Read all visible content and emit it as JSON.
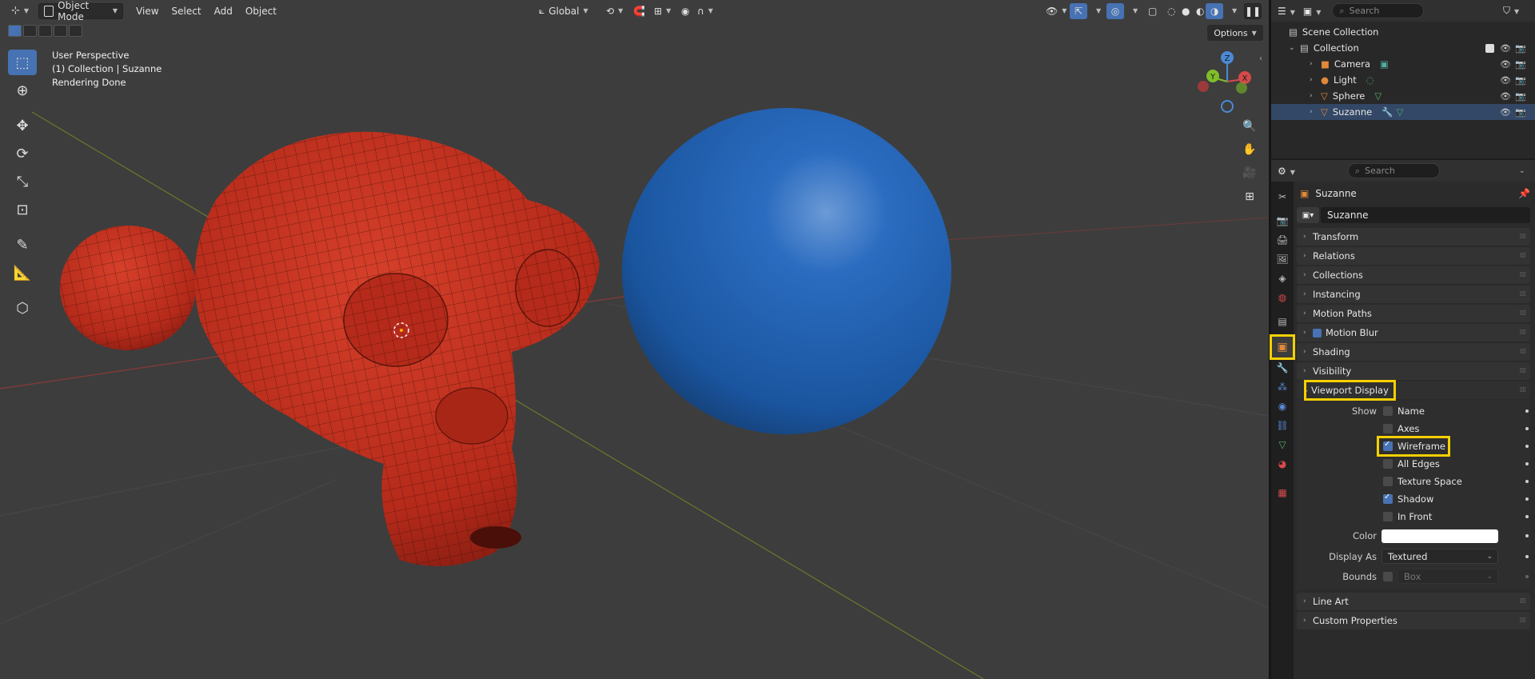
{
  "viewport": {
    "header": {
      "mode": "Object Mode",
      "menus": [
        "View",
        "Select",
        "Add",
        "Object"
      ],
      "transform_orientation": "Global",
      "options_label": "Options"
    },
    "info": {
      "line1": "User Perspective",
      "line2": "(1) Collection | Suzanne",
      "line3": "Rendering Done"
    },
    "gizmo": {
      "z": "Z",
      "y": "Y",
      "x": "X"
    },
    "colors": {
      "suzanne": "#c0301f",
      "sphere": "#1e5fb0",
      "background": "#3d3d3d",
      "accent": "#4772b3",
      "highlight": "#f5d000"
    }
  },
  "outliner": {
    "search_placeholder": "Search",
    "scene_collection": "Scene Collection",
    "collection": "Collection",
    "items": [
      {
        "label": "Camera",
        "icon": "camera-icon"
      },
      {
        "label": "Light",
        "icon": "light-icon"
      },
      {
        "label": "Sphere",
        "icon": "mesh-icon"
      },
      {
        "label": "Suzanne",
        "icon": "mesh-icon"
      }
    ]
  },
  "properties": {
    "search_placeholder": "Search",
    "object_name_title": "Suzanne",
    "object_name_field": "Suzanne",
    "panels": [
      "Transform",
      "Relations",
      "Collections",
      "Instancing",
      "Motion Paths",
      "Motion Blur",
      "Shading",
      "Visibility"
    ],
    "viewport_display": {
      "title": "Viewport Display",
      "show_label": "Show",
      "checkboxes": [
        {
          "label": "Name",
          "checked": false
        },
        {
          "label": "Axes",
          "checked": false
        },
        {
          "label": "Wireframe",
          "checked": true
        },
        {
          "label": "All Edges",
          "checked": false
        },
        {
          "label": "Texture Space",
          "checked": false
        },
        {
          "label": "Shadow",
          "checked": true
        },
        {
          "label": "In Front",
          "checked": false
        }
      ],
      "color_label": "Color",
      "color_value": "#ffffff",
      "display_as_label": "Display As",
      "display_as_value": "Textured",
      "bounds_label": "Bounds",
      "bounds_value": "Box"
    },
    "bottom_panels": [
      "Line Art",
      "Custom Properties"
    ]
  }
}
